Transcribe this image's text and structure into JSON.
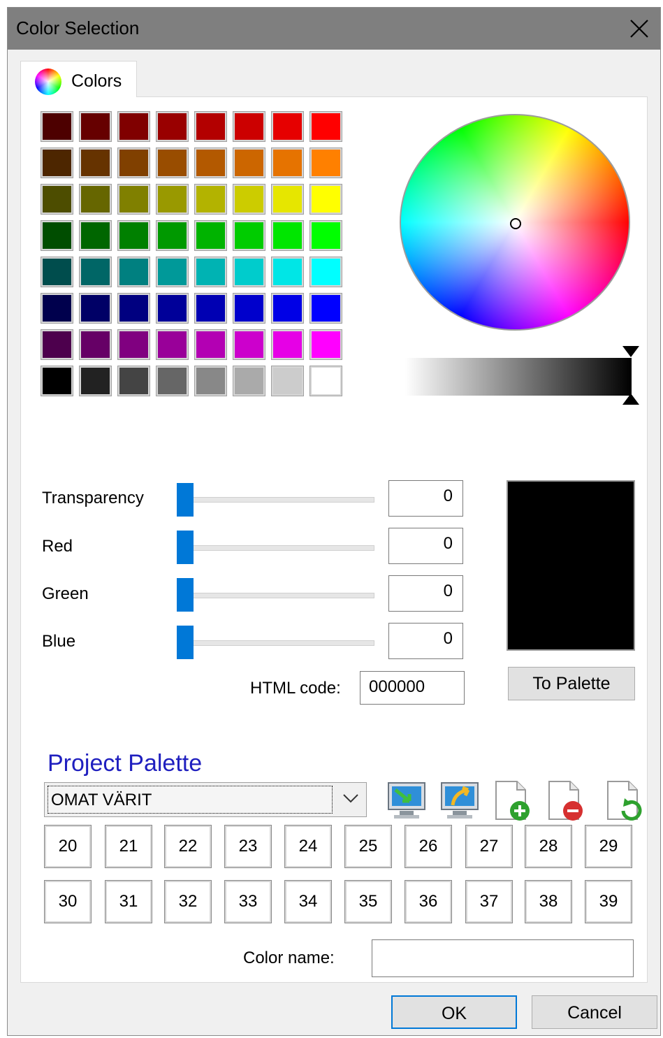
{
  "window": {
    "title": "Color Selection"
  },
  "tabs": [
    {
      "label": "Colors",
      "icon": "color-wheel-icon"
    }
  ],
  "basic_colors": [
    [
      "#4d0000",
      "#660000",
      "#800000",
      "#990000",
      "#b30000",
      "#cc0000",
      "#e60000",
      "#ff0000"
    ],
    [
      "#4d2600",
      "#663300",
      "#804000",
      "#994d00",
      "#b35900",
      "#cc6600",
      "#e67300",
      "#ff8000"
    ],
    [
      "#4d4d00",
      "#666600",
      "#808000",
      "#999900",
      "#b3b300",
      "#cccc00",
      "#e6e600",
      "#ffff00"
    ],
    [
      "#004d00",
      "#006600",
      "#008000",
      "#009900",
      "#00b300",
      "#00cc00",
      "#00e600",
      "#00ff00"
    ],
    [
      "#004d4d",
      "#006666",
      "#008080",
      "#009999",
      "#00b3b3",
      "#00cccc",
      "#00e6e6",
      "#00ffff"
    ],
    [
      "#00004d",
      "#000066",
      "#000080",
      "#000099",
      "#0000b3",
      "#0000cc",
      "#0000e6",
      "#0000ff"
    ],
    [
      "#4d004d",
      "#660066",
      "#800080",
      "#990099",
      "#b300b3",
      "#cc00cc",
      "#e600e6",
      "#ff00ff"
    ],
    [
      "#000000",
      "#222222",
      "#444444",
      "#666666",
      "#888888",
      "#aaaaaa",
      "#cccccc",
      "#ffffff"
    ]
  ],
  "sliders": [
    {
      "label": "Transparency",
      "value": "0",
      "level": 0
    },
    {
      "label": "Red",
      "value": "0",
      "level": 0
    },
    {
      "label": "Green",
      "value": "0",
      "level": 0
    },
    {
      "label": "Blue",
      "value": "0",
      "level": 0
    }
  ],
  "html_code": {
    "label": "HTML code:",
    "value": "000000"
  },
  "preview_color": "#000000",
  "to_palette_label": "To Palette",
  "project_palette": {
    "title": "Project Palette",
    "selected": "OMAT VÄRIT",
    "tools": [
      "import-palette-icon",
      "export-palette-icon",
      "add-palette-icon",
      "remove-palette-icon",
      "refresh-palette-icon"
    ],
    "cells": [
      [
        "20",
        "21",
        "22",
        "23",
        "24",
        "25",
        "26",
        "27",
        "28",
        "29"
      ],
      [
        "30",
        "31",
        "32",
        "33",
        "34",
        "35",
        "36",
        "37",
        "38",
        "39"
      ]
    ]
  },
  "color_name": {
    "label": "Color name:",
    "value": ""
  },
  "buttons": {
    "ok": "OK",
    "cancel": "Cancel"
  },
  "accent_color": "#0078d7",
  "title_color": "#1f1fbf"
}
